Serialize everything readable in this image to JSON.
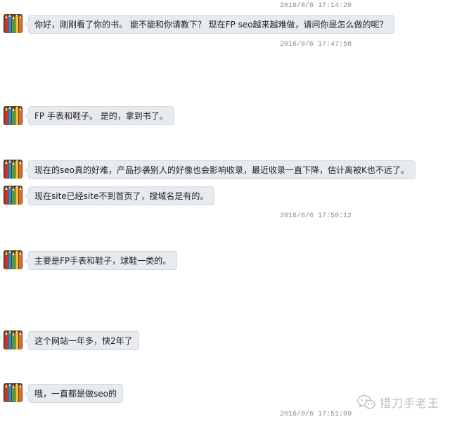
{
  "messages": [
    {
      "text": "你好，刚刚看了你的书。 能不能和你请教下？ 现在FP seo越来越难做，请问你是怎么做的呢？"
    },
    {
      "text": "FP 手表和鞋子。 是的，拿到书了。"
    },
    {
      "text": "现在的seo真的好难，产品抄袭别人的好像也会影响收录，最近收录一直下降，估计离被K也不远了。"
    },
    {
      "text": "现在site已经site不到首页了，搜域名是有的。"
    },
    {
      "text": "主要是FP手表和鞋子，球鞋一类的。"
    },
    {
      "text": "这个网站一年多，快2年了"
    },
    {
      "text": "哦，一直都是做seo的"
    }
  ],
  "timestamps": [
    "2016/8/6 17:14:20",
    "2016/8/6 17:47:58",
    "2016/8/6 17:50:12",
    "2016/8/6 17:51:09"
  ],
  "watermark": {
    "text": "猎刀手老王",
    "icon": "wechat-icon"
  }
}
